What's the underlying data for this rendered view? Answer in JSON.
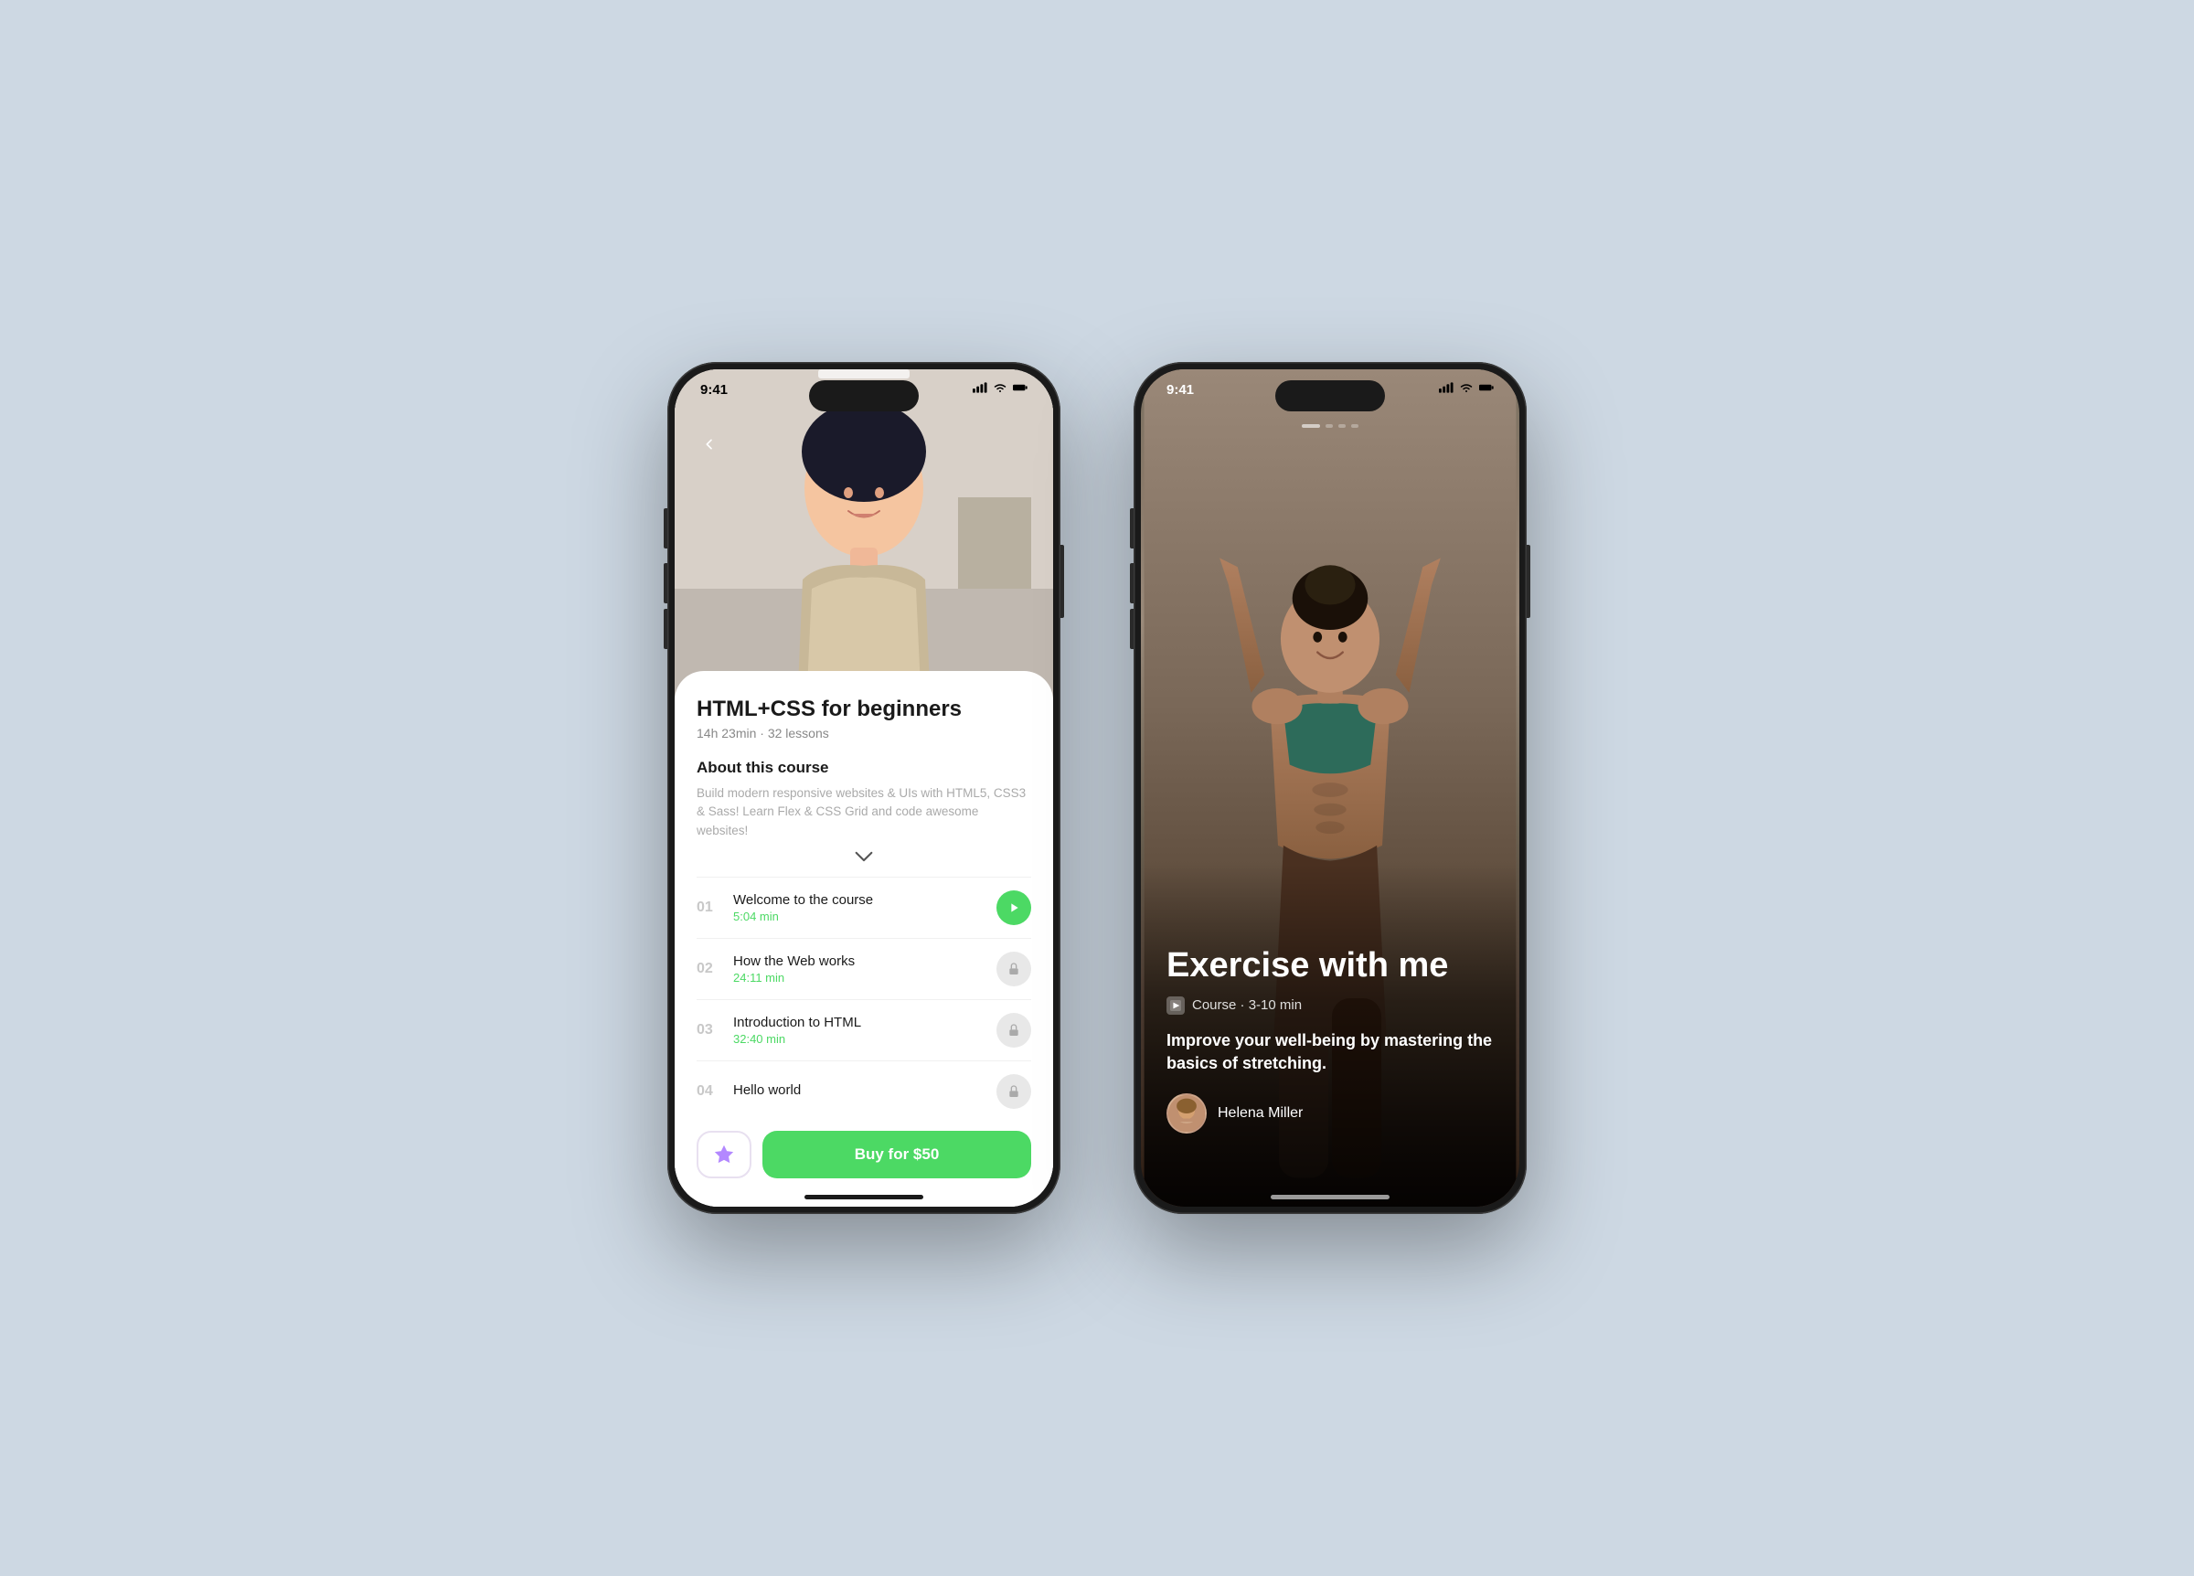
{
  "background_color": "#cdd8e3",
  "phone1": {
    "status": {
      "time": "9:41",
      "signal": "signal-icon",
      "wifi": "wifi-icon",
      "battery": "battery-icon"
    },
    "hero_image_desc": "Young woman with dark hair smiling in a classroom/lab setting",
    "back_button_label": "<",
    "course": {
      "title": "HTML+CSS for beginners",
      "meta": "14h 23min · 32 lessons",
      "about_label": "About this course",
      "description": "Build modern responsive websites & UIs with HTML5, CSS3 & Sass! Learn Flex & CSS Grid and code awesome websites!",
      "lessons": [
        {
          "num": "01",
          "name": "Welcome to the course",
          "duration": "5:04 min",
          "status": "active"
        },
        {
          "num": "02",
          "name": "How the Web works",
          "duration": "24:11 min",
          "status": "locked"
        },
        {
          "num": "03",
          "name": "Introduction to HTML",
          "duration": "32:40 min",
          "status": "locked"
        },
        {
          "num": "04",
          "name": "Hello world",
          "duration": "",
          "status": "locked"
        }
      ]
    },
    "buy_button_label": "Buy for $50",
    "fav_button_label": "★"
  },
  "phone2": {
    "status": {
      "time": "9:41",
      "signal": "signal-icon",
      "wifi": "wifi-icon",
      "battery": "battery-icon"
    },
    "pagination_dots": [
      "active",
      "inactive",
      "inactive",
      "inactive"
    ],
    "exercise": {
      "title": "Exercise with me",
      "type_icon": "▶",
      "type_label": "Course",
      "duration": "3-10 min",
      "description": "Improve your well-being by mastering the basics of stretching.",
      "instructor": {
        "name": "Helena Miller",
        "avatar_desc": "Woman with natural hair smiling"
      }
    }
  }
}
